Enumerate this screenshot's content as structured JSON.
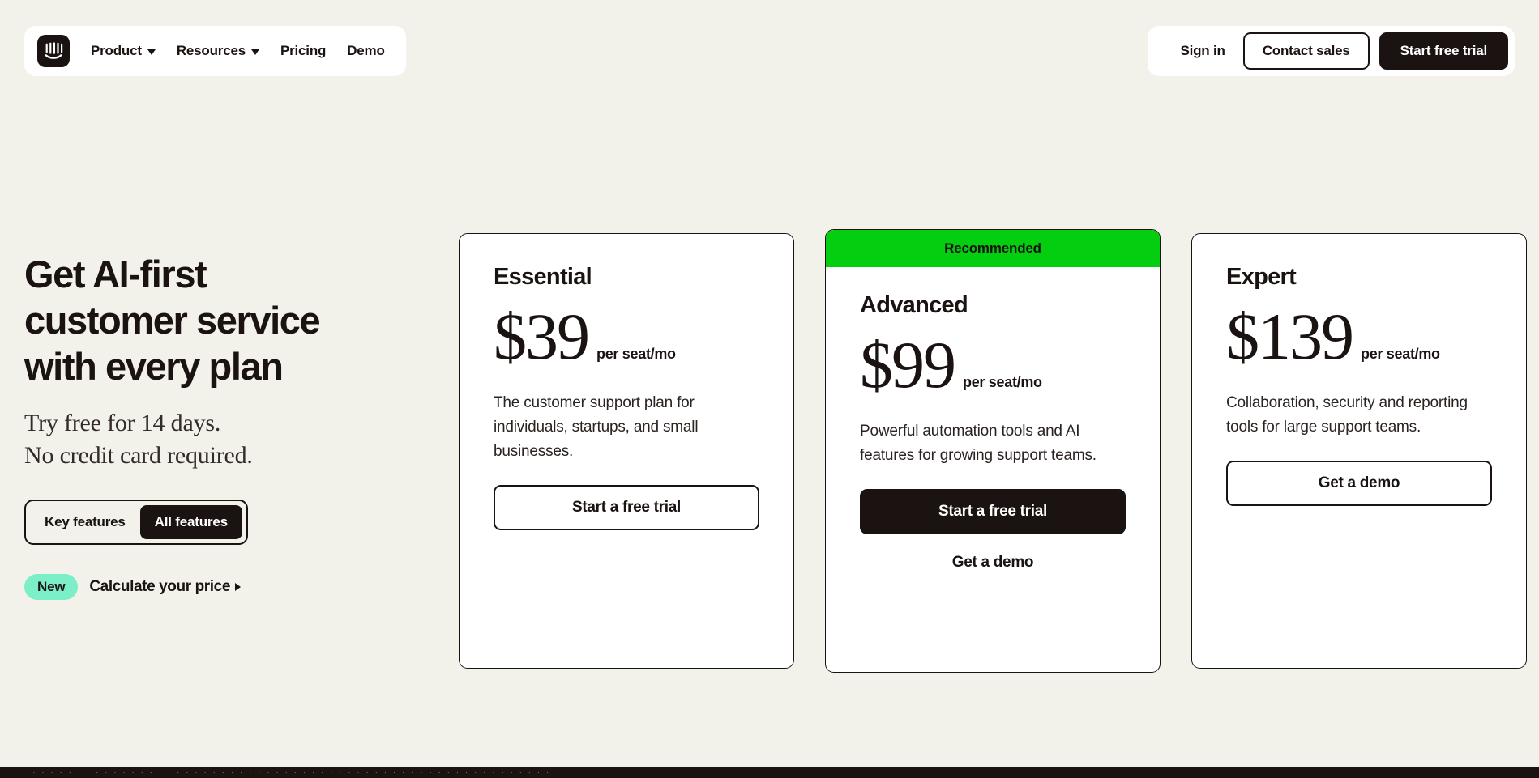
{
  "nav": {
    "logo_name": "intercom-logo",
    "links": [
      {
        "label": "Product",
        "has_caret": true
      },
      {
        "label": "Resources",
        "has_caret": true
      },
      {
        "label": "Pricing",
        "has_caret": false
      },
      {
        "label": "Demo",
        "has_caret": false
      }
    ],
    "signin_label": "Sign in",
    "contact_label": "Contact sales",
    "trial_label": "Start free trial"
  },
  "hero": {
    "title_line1": "Get AI-first",
    "title_line2": "customer service",
    "title_line3": "with every plan",
    "sub_line1": "Try free for 14 days.",
    "sub_line2": "No credit card required.",
    "toggle": {
      "options": [
        "Key features",
        "All features"
      ],
      "selected": "All features"
    },
    "badge_new": "New",
    "calculate_label": "Calculate your price"
  },
  "plans": [
    {
      "ribbon": null,
      "name": "Essential",
      "price": "$39",
      "unit": "per seat/mo",
      "desc": "The customer support plan for individuals, startups, and small businesses.",
      "cta_label": "Start a free trial",
      "cta_style": "outline",
      "secondary_label": null
    },
    {
      "ribbon": "Recommended",
      "name": "Advanced",
      "price": "$99",
      "unit": "per seat/mo",
      "desc": "Powerful automation tools and AI features for growing support teams.",
      "cta_label": "Start a free trial",
      "cta_style": "solid",
      "secondary_label": "Get a demo"
    },
    {
      "ribbon": null,
      "name": "Expert",
      "price": "$139",
      "unit": "per seat/mo",
      "desc": "Collaboration, security and reporting tools for large support teams.",
      "cta_label": "Get a demo",
      "cta_style": "outline",
      "secondary_label": null
    }
  ],
  "footer": {
    "edge_text": "· · · · · · · · · · · · · · · · · · · · · · · · · · · · · · · · · · · · · · · · · · · · · · · · · · · · · · · · · ·"
  },
  "colors": {
    "background": "#F2F1EA",
    "ink": "#1A1311",
    "card": "#FFFFFF",
    "recommended_green": "#04CE10",
    "badge_mint": "#7AEFC8"
  }
}
